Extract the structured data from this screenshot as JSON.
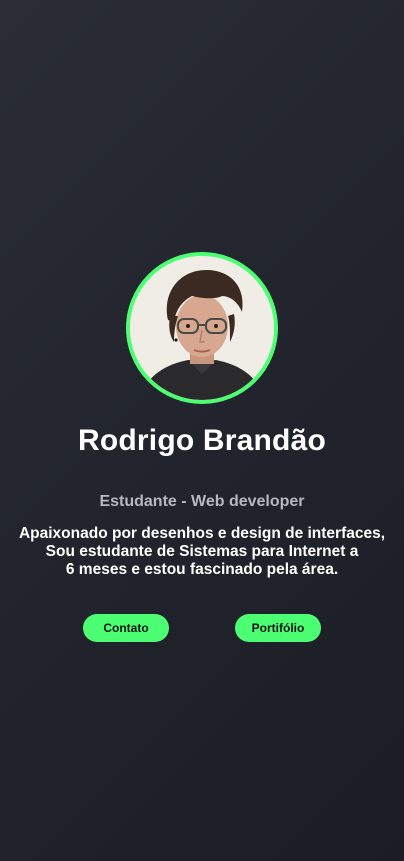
{
  "profile": {
    "name": "Rodrigo Brandão",
    "role": "Estudante - Web developer",
    "bio_lines": [
      "Apaixonado por desenhos e design de interfaces,",
      "Sou estudante de Sistemas para Internet a",
      "6 meses e estou fascinado pela área."
    ]
  },
  "actions": {
    "contact_label": "Contato",
    "portfolio_label": "Portifólio"
  },
  "colors": {
    "accent": "#4cff72",
    "background": "#22252e",
    "muted_text": "#b4b8c0"
  }
}
